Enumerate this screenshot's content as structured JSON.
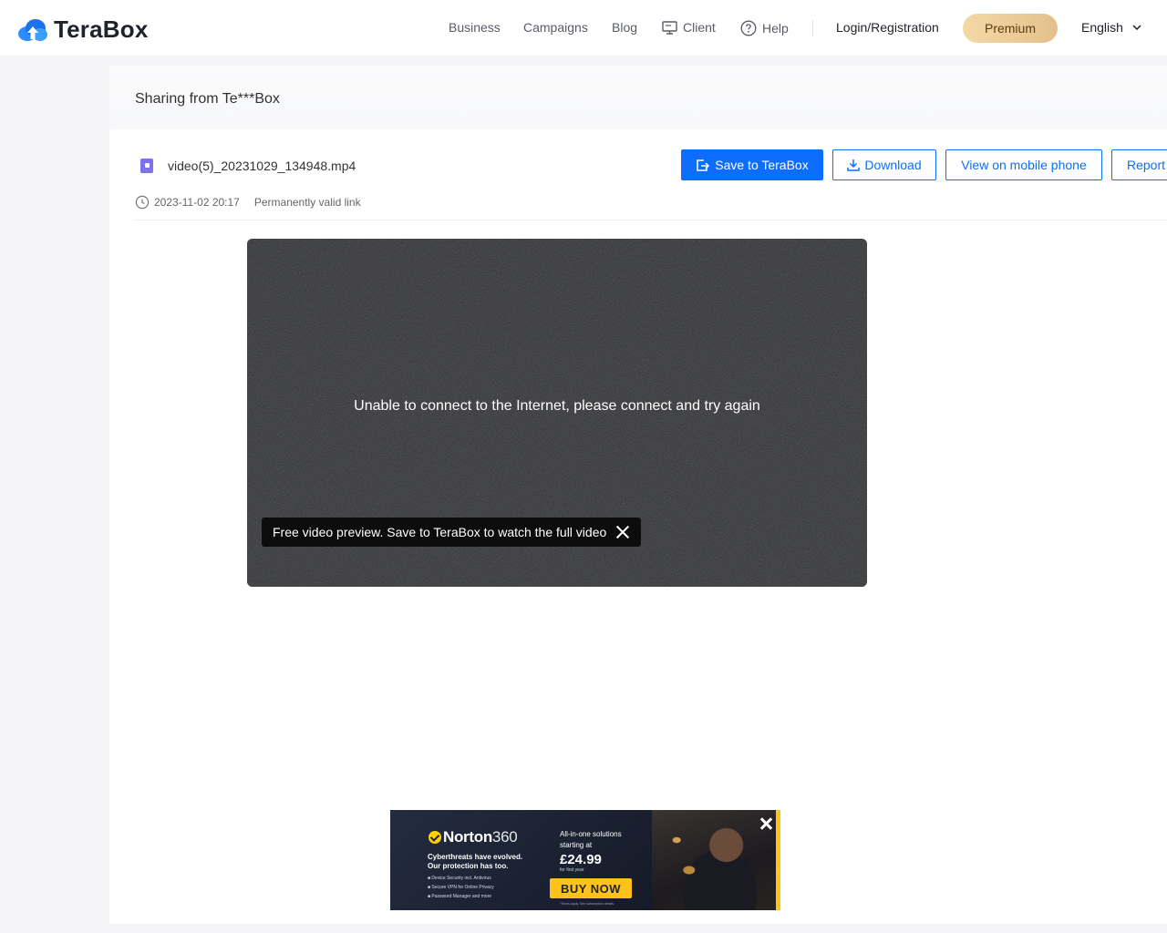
{
  "header": {
    "brand": "TeraBox",
    "nav": [
      {
        "label": "Business",
        "icon": ""
      },
      {
        "label": "Campaigns",
        "icon": ""
      },
      {
        "label": "Blog",
        "icon": ""
      },
      {
        "label": "Client",
        "icon": "monitor-icon"
      },
      {
        "label": "Help",
        "icon": "help-circle-icon"
      }
    ],
    "login_label": "Login/Registration",
    "premium_label": "Premium",
    "language_label": "English"
  },
  "share": {
    "title": "Sharing from Te***Box"
  },
  "file": {
    "name": "video(5)_20231029_134948.mp4",
    "date": "2023-11-02 20:17",
    "validity": "Permanently valid link",
    "icon": "video-file-icon"
  },
  "actions": {
    "save_label": "Save to TeraBox",
    "download_label": "Download",
    "mobile_label": "View on mobile phone",
    "report_label": "Report"
  },
  "video": {
    "error_message": "Unable to connect to the Internet, please connect and try again",
    "preview_tip": "Free video preview. Save to TeraBox to watch the full video"
  },
  "ad": {
    "brand": "Norton",
    "brand_num": "360",
    "headline": "Cyberthreats have evolved. Our protection has too.",
    "features": [
      "Device Security incl. Antivirus",
      "Secure VPN for Online Privacy",
      "Password Manager and more"
    ],
    "offer_line": "All-in-one solutions starting at",
    "price": "£24.99",
    "price_note": "for first year",
    "cta": "BUY NOW",
    "terms": "*Terms apply. See subscription details.",
    "accent_color": "#ffc21a"
  },
  "colors": {
    "primary": "#0d6efd",
    "premium_gradient_start": "#f3d9a6",
    "premium_gradient_end": "#e4c08b"
  }
}
